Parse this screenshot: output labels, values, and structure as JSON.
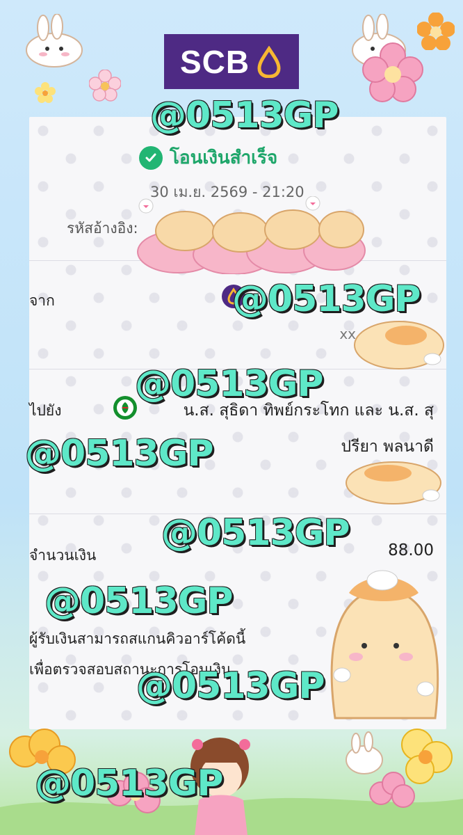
{
  "bank": {
    "name": "SCB"
  },
  "receipt": {
    "status": "โอนเงินสำเร็จ",
    "datetime": "30 เม.ย. 2569 - 21:20",
    "ref_label": "รหัสอ้างอิง:",
    "from_label": "จาก",
    "from_account": "xx",
    "to_label": "ไปยัง",
    "to_name_line1": "น.ส. สุธิดา ทิพย์กระโทก และ น.ส. สุ",
    "to_name_line2": "ปรียา พลนาดี",
    "amount_label": "จำนวนเงิน",
    "amount": "88.00",
    "note_line1": "ผู้รับเงินสามารถสแกนคิวอาร์โค้ดนี้",
    "note_line2": "เพื่อตรวจสอบสถานะการโอนเงิน"
  },
  "watermark": "@0513GP",
  "colors": {
    "scb_purple": "#4e2a84",
    "success_green": "#22b573",
    "watermark_teal": "#5ee8c8",
    "kbank_green": "#138f2d"
  }
}
